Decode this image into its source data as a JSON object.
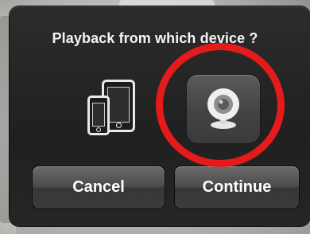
{
  "dialog": {
    "title": "Playback from which device ?",
    "options": [
      {
        "icon": "phone-tablet-icon"
      },
      {
        "icon": "webcam-icon"
      }
    ],
    "buttons": {
      "cancel_label": "Cancel",
      "continue_label": "Continue"
    }
  },
  "colors": {
    "dialog_bg": "#222322",
    "button_bg": "#4a4b4a",
    "text": "#ffffff",
    "highlight": "#e51b1b"
  }
}
